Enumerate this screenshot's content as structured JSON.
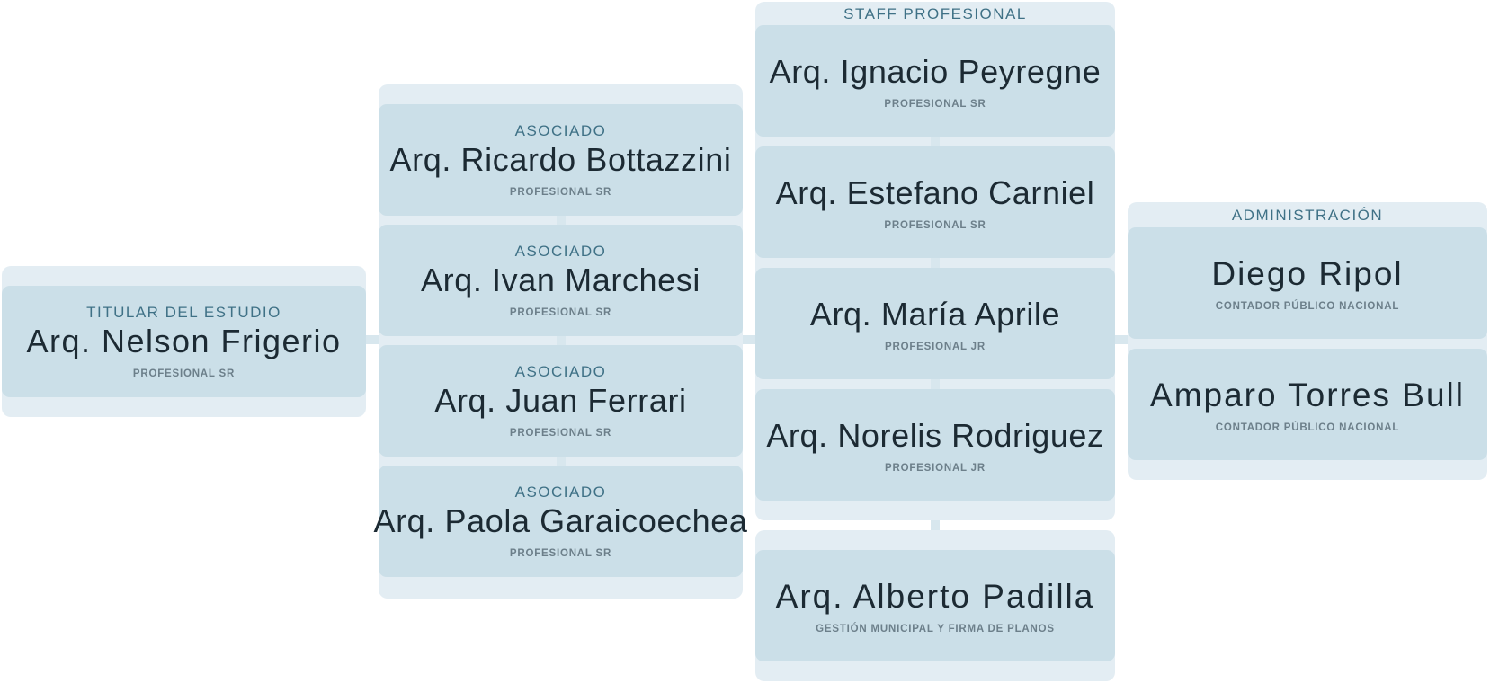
{
  "titular": {
    "role": "TITULAR DEL ESTUDIO",
    "name": "Arq. Nelson Frigerio",
    "subtitle": "PROFESIONAL SR"
  },
  "asociados": [
    {
      "role": "ASOCIADO",
      "name": "Arq. Ricardo Bottazzini",
      "subtitle": "PROFESIONAL SR"
    },
    {
      "role": "ASOCIADO",
      "name": "Arq. Ivan Marchesi",
      "subtitle": "PROFESIONAL SR"
    },
    {
      "role": "ASOCIADO",
      "name": "Arq. Juan Ferrari",
      "subtitle": "PROFESIONAL SR"
    },
    {
      "role": "ASOCIADO",
      "name": "Arq. Paola Garaicoechea",
      "subtitle": "PROFESIONAL SR"
    }
  ],
  "staff": {
    "title": "STAFF PROFESIONAL",
    "members": [
      {
        "name": "Arq. Ignacio Peyregne",
        "subtitle": "PROFESIONAL SR"
      },
      {
        "name": "Arq. Estefano Carniel",
        "subtitle": "PROFESIONAL SR"
      },
      {
        "name": "Arq. María Aprile",
        "subtitle": "PROFESIONAL JR"
      },
      {
        "name": "Arq. Norelis Rodriguez",
        "subtitle": "PROFESIONAL JR"
      }
    ]
  },
  "gestion": {
    "name": "Arq. Alberto Padilla",
    "subtitle": "GESTIÓN MUNICIPAL Y FIRMA DE PLANOS"
  },
  "administracion": {
    "title": "ADMINISTRACIÓN",
    "members": [
      {
        "name": "Diego Ripol",
        "subtitle": "CONTADOR PÚBLICO NACIONAL"
      },
      {
        "name": "Amparo Torres Bull",
        "subtitle": "CONTADOR PÚBLICO NACIONAL"
      }
    ]
  },
  "colors": {
    "group_background": "#e3edf3",
    "card_background": "#cbdfe8",
    "connector": "#d8e7ee",
    "role_text": "#3f7186",
    "name_text": "#1c2a33",
    "subtitle_text": "#6c7f8a"
  }
}
